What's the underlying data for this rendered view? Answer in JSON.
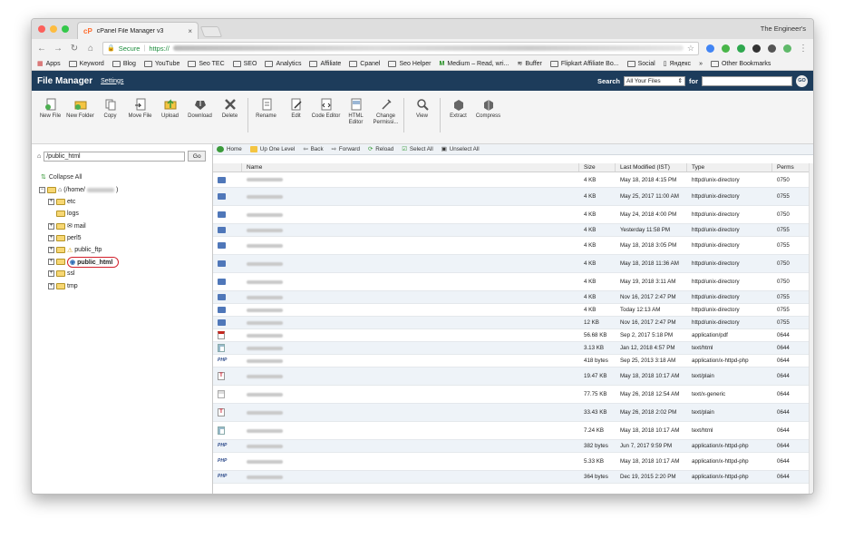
{
  "browser": {
    "tab_title": "cPanel File Manager v3",
    "tab_favicon": "cP",
    "tab_close": "×",
    "profile_name": "The Engineer's",
    "secure_label": "Secure",
    "url_scheme": "https://",
    "bookmarks": [
      "Apps",
      "Keyword",
      "Blog",
      "YouTube",
      "Seo TEC",
      "SEO",
      "Analytics",
      "Affiliate",
      "Cpanel",
      "Seo Helper",
      "Medium – Read, wri...",
      "Buffer",
      "Flipkart Affiliate Bo...",
      "Social",
      "Яндекс"
    ],
    "bookmarks_overflow": "»",
    "other_bookmarks": "Other Bookmarks"
  },
  "header": {
    "title": "File Manager",
    "settings": "Settings",
    "search_label": "Search",
    "search_scope": "All Your Files",
    "search_for": "for",
    "search_go": "GO"
  },
  "toolbar": [
    {
      "label": "New File",
      "icon": "new-file-icon"
    },
    {
      "label": "New Folder",
      "icon": "new-folder-icon"
    },
    {
      "label": "Copy",
      "icon": "copy-icon"
    },
    {
      "label": "Move File",
      "icon": "move-file-icon"
    },
    {
      "label": "Upload",
      "icon": "upload-icon"
    },
    {
      "label": "Download",
      "icon": "download-icon"
    },
    {
      "label": "Delete",
      "icon": "delete-icon"
    },
    {
      "label": "Rename",
      "icon": "rename-icon"
    },
    {
      "label": "Edit",
      "icon": "edit-icon"
    },
    {
      "label": "Code Editor",
      "icon": "code-editor-icon"
    },
    {
      "label": "HTML Editor",
      "icon": "html-editor-icon"
    },
    {
      "label": "Change Permissi...",
      "icon": "permissions-icon"
    },
    {
      "label": "View",
      "icon": "view-icon"
    },
    {
      "label": "Extract",
      "icon": "extract-icon"
    },
    {
      "label": "Compress",
      "icon": "compress-icon"
    }
  ],
  "left": {
    "path_value": "/public_html",
    "go": "Go",
    "collapse_all": "Collapse All",
    "root_label": "(/home/",
    "tree": [
      "etc",
      "logs",
      "mail",
      "perl5",
      "public_ftp",
      "public_html",
      "ssl",
      "tmp"
    ]
  },
  "nav": {
    "home": "Home",
    "up": "Up One Level",
    "back": "Back",
    "forward": "Forward",
    "reload": "Reload",
    "select_all": "Select All",
    "unselect_all": "Unselect All"
  },
  "table": {
    "headers": {
      "name": "Name",
      "size": "Size",
      "modified": "Last Modified (IST)",
      "type": "Type",
      "perms": "Perms"
    },
    "rows": [
      {
        "icon": "folder",
        "size": "4 KB",
        "modified": "May 18, 2018 4:15 PM",
        "type": "httpd/unix-directory",
        "perms": "0750"
      },
      {
        "icon": "folder",
        "size": "4 KB",
        "modified": "May 25, 2017 11:00 AM",
        "type": "httpd/unix-directory",
        "perms": "0755"
      },
      {
        "icon": "folder",
        "size": "4 KB",
        "modified": "May 24, 2018 4:00 PM",
        "type": "httpd/unix-directory",
        "perms": "0750"
      },
      {
        "icon": "folder",
        "size": "4 KB",
        "modified": "Yesterday 11:58 PM",
        "type": "httpd/unix-directory",
        "perms": "0755"
      },
      {
        "icon": "folder",
        "size": "4 KB",
        "modified": "May 18, 2018 3:05 PM",
        "type": "httpd/unix-directory",
        "perms": "0755"
      },
      {
        "icon": "folder",
        "size": "4 KB",
        "modified": "May 18, 2018 11:36 AM",
        "type": "httpd/unix-directory",
        "perms": "0750"
      },
      {
        "icon": "folder",
        "size": "4 KB",
        "modified": "May 19, 2018 3:11 AM",
        "type": "httpd/unix-directory",
        "perms": "0750"
      },
      {
        "icon": "folder",
        "size": "4 KB",
        "modified": "Nov 16, 2017 2:47 PM",
        "type": "httpd/unix-directory",
        "perms": "0755"
      },
      {
        "icon": "folder",
        "size": "4 KB",
        "modified": "Today 12:13 AM",
        "type": "httpd/unix-directory",
        "perms": "0755"
      },
      {
        "icon": "folder",
        "size": "12 KB",
        "modified": "Nov 16, 2017 2:47 PM",
        "type": "httpd/unix-directory",
        "perms": "0755"
      },
      {
        "icon": "pdf",
        "size": "56.68 KB",
        "modified": "Sep 2, 2017 5:18 PM",
        "type": "application/pdf",
        "perms": "0644"
      },
      {
        "icon": "html",
        "size": "3.13 KB",
        "modified": "Jan 12, 2018 4:57 PM",
        "type": "text/html",
        "perms": "0644"
      },
      {
        "icon": "php",
        "size": "418 bytes",
        "modified": "Sep 25, 2013 3:18 AM",
        "type": "application/x-httpd-php",
        "perms": "0644"
      },
      {
        "icon": "text",
        "size": "19.47 KB",
        "modified": "May 18, 2018 10:17 AM",
        "type": "text/plain",
        "perms": "0644"
      },
      {
        "icon": "generic",
        "size": "77.75 KB",
        "modified": "May 26, 2018 12:54 AM",
        "type": "text/x-generic",
        "perms": "0644"
      },
      {
        "icon": "text",
        "size": "33.43 KB",
        "modified": "May 26, 2018 2:02 PM",
        "type": "text/plain",
        "perms": "0644"
      },
      {
        "icon": "html",
        "size": "7.24 KB",
        "modified": "May 18, 2018 10:17 AM",
        "type": "text/html",
        "perms": "0644"
      },
      {
        "icon": "php",
        "size": "382 bytes",
        "modified": "Jun 7, 2017 9:59 PM",
        "type": "application/x-httpd-php",
        "perms": "0644"
      },
      {
        "icon": "php",
        "size": "5.33 KB",
        "modified": "May 18, 2018 10:17 AM",
        "type": "application/x-httpd-php",
        "perms": "0644"
      },
      {
        "icon": "php",
        "size": "364 bytes",
        "modified": "Dec 19, 2015 2:20 PM",
        "type": "application/x-httpd-php",
        "perms": "0644"
      }
    ]
  },
  "colors": {
    "header_bg": "#1d3c5b",
    "accent_green": "#1e8e3e",
    "highlight_red": "#d21f2b",
    "folder_blue": "#4f77b9"
  }
}
